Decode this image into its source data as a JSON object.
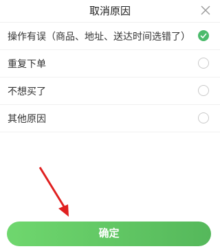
{
  "header": {
    "title": "取消原因",
    "close_icon": "close-icon"
  },
  "reasons": [
    {
      "label": "操作有误（商品、地址、送达时间选错了）",
      "selected": true
    },
    {
      "label": "重复下单",
      "selected": false
    },
    {
      "label": "不想买了",
      "selected": false
    },
    {
      "label": "其他原因",
      "selected": false
    }
  ],
  "confirm_label": "确定",
  "colors": {
    "accent": "#4cbb6c",
    "button_start": "#6fd76e",
    "button_end": "#55b85b",
    "annotation_arrow": "#e02020"
  }
}
